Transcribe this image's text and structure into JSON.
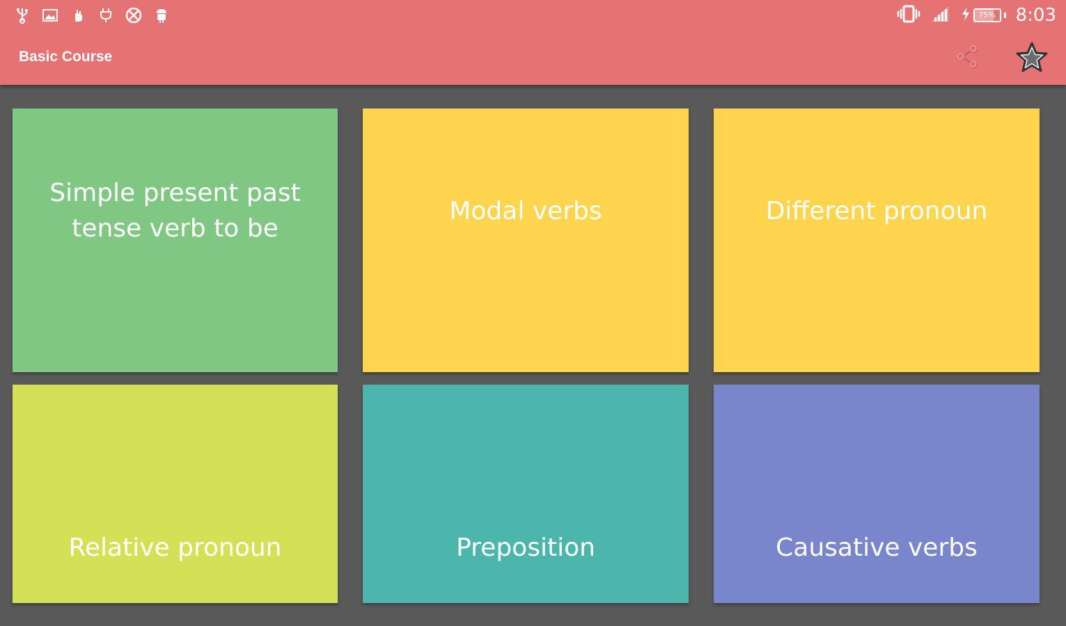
{
  "status_bar": {
    "time": "8:03",
    "battery_text": "75%",
    "battery_level": 0.75,
    "left_icons": [
      "usb-icon",
      "image-icon",
      "hand-icon",
      "plug-icon",
      "blocked-icon",
      "android-icon"
    ],
    "right_icons": [
      "vibrate-icon",
      "signal-icon",
      "charging-icon",
      "battery-icon"
    ]
  },
  "appbar": {
    "title": "Basic Course",
    "actions": [
      "share-icon",
      "star-icon"
    ],
    "background": "#e57373"
  },
  "tiles": [
    {
      "label": "Simple present past tense verb to be",
      "color": "#81c784"
    },
    {
      "label": "Modal verbs",
      "color": "#ffd54f"
    },
    {
      "label": "Different pronoun",
      "color": "#ffd54f"
    },
    {
      "label": "Relative pronoun",
      "color": "#d4e157"
    },
    {
      "label": "Preposition",
      "color": "#4db6ac"
    },
    {
      "label": "Causative verbs",
      "color": "#7986cb"
    }
  ],
  "background": "#595959"
}
